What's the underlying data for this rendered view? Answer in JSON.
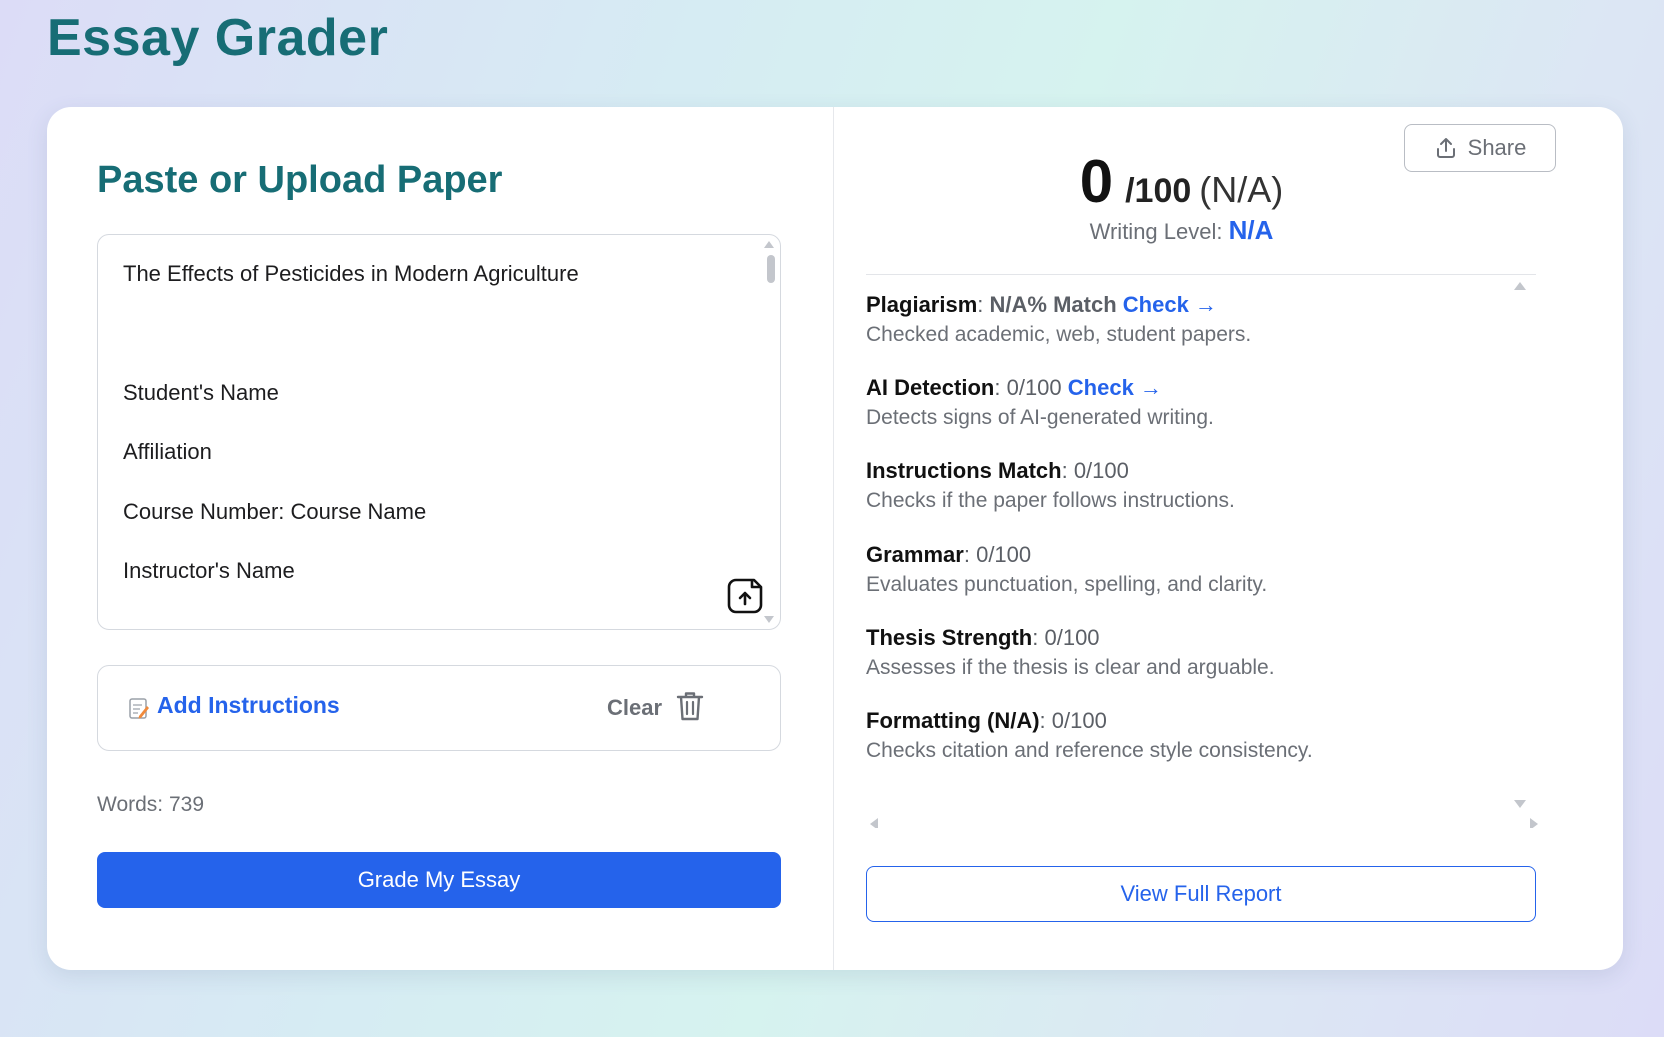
{
  "app": {
    "title": "Essay Grader"
  },
  "left": {
    "heading": "Paste or Upload Paper",
    "essay_lines": [
      "The Effects of Pesticides in Modern Agriculture",
      "Student's Name",
      "Affiliation",
      "Course Number: Course Name",
      "Instructor's Name"
    ],
    "upload_icon": "upload-file-icon",
    "instructions": {
      "icon": "memo-icon",
      "add_label": "Add Instructions",
      "clear_label": "Clear",
      "clear_icon": "trash-icon"
    },
    "words_label": "Words: 739",
    "grade_button": "Grade My Essay"
  },
  "right": {
    "share_label": "Share",
    "share_icon": "share-upload-icon",
    "score": {
      "value": "0",
      "max": "/100",
      "grade": "(N/A)",
      "level_label": "Writing Level:",
      "level_value": "N/A"
    },
    "metrics": [
      {
        "name": "Plagiarism",
        "value": "N/A% Match",
        "check": "Check →",
        "description": "Checked academic, web, student papers."
      },
      {
        "name": "AI Detection",
        "value": "0/100",
        "check": "Check →",
        "description": "Detects signs of AI-generated writing."
      },
      {
        "name": "Instructions Match",
        "value": "0/100",
        "description": "Checks if the paper follows instructions."
      },
      {
        "name": "Grammar",
        "value": "0/100",
        "description": "Evaluates punctuation, spelling, and clarity."
      },
      {
        "name": "Thesis Strength",
        "value": "0/100",
        "description": "Assesses if the thesis is clear and arguable."
      },
      {
        "name": "Formatting (N/A)",
        "value": "0/100",
        "description": "Checks citation and reference style consistency."
      }
    ],
    "report_button": "View Full Report"
  },
  "colors": {
    "brand_teal": "#176d75",
    "accent_blue": "#2563eb",
    "muted_text": "#6b6f76"
  }
}
